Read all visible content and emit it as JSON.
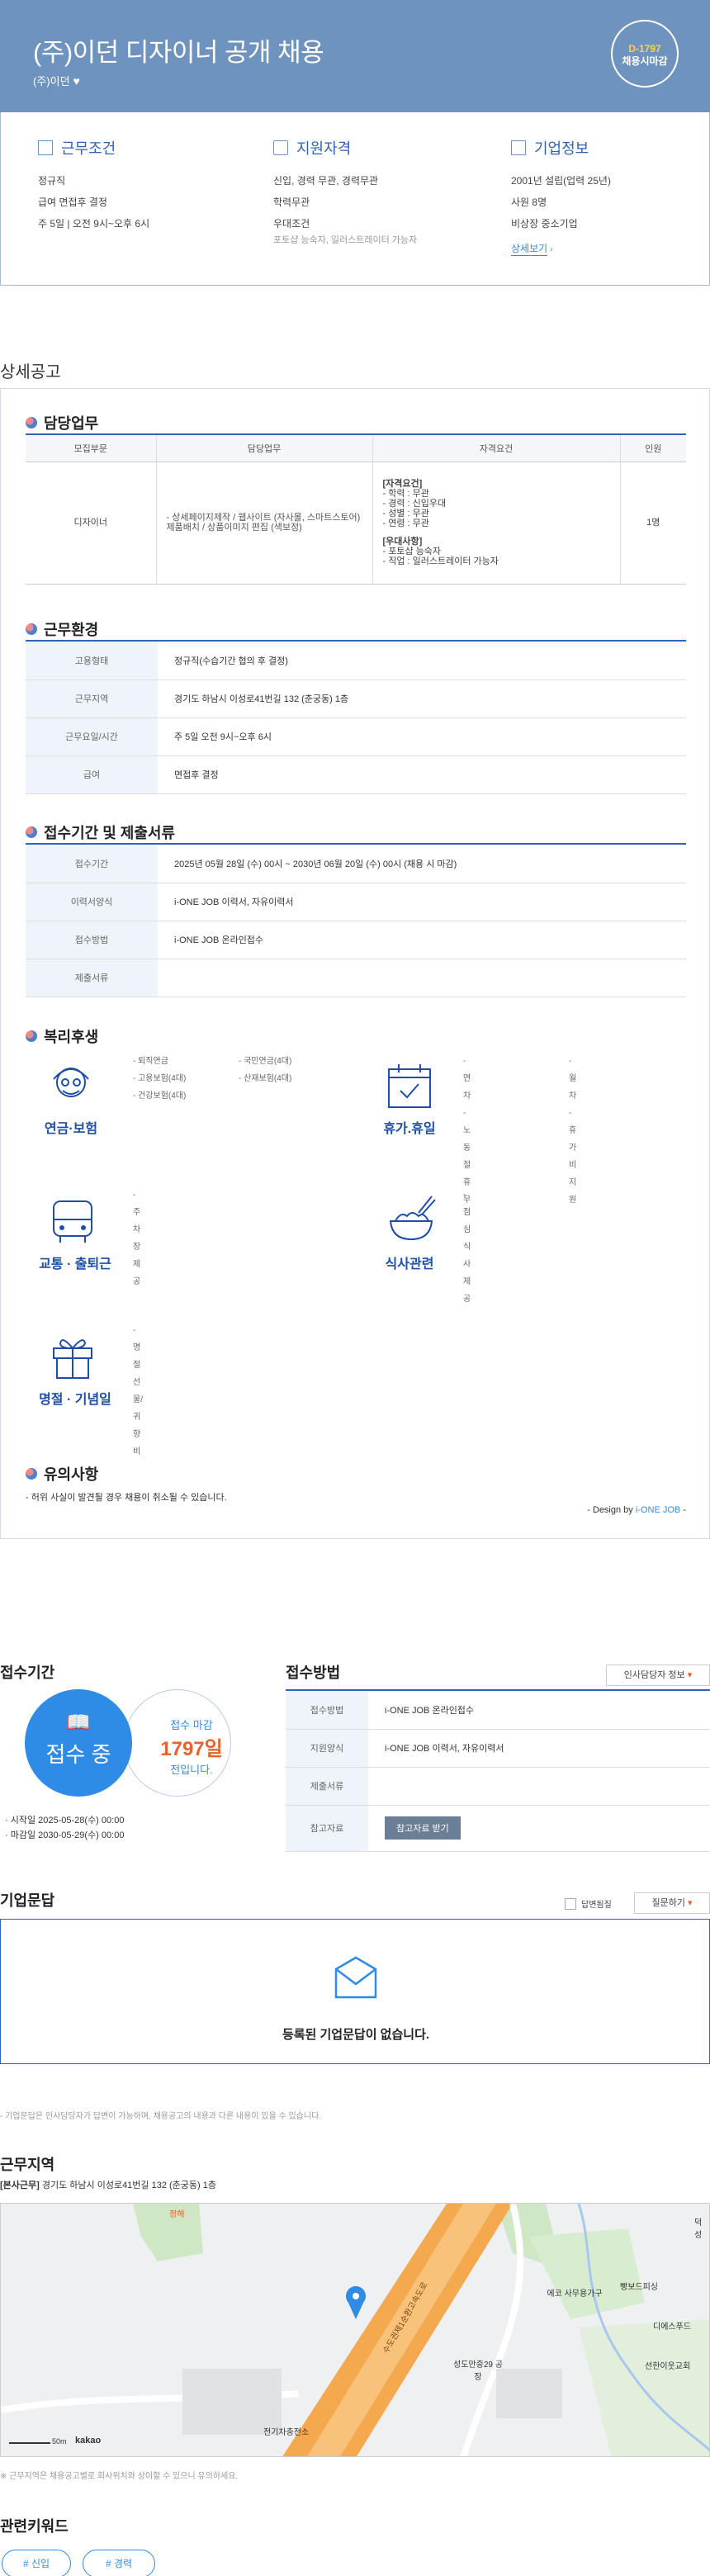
{
  "header": {
    "title": "(주)이던 디자이너 공개 채용",
    "company": "(주)이던",
    "dday": "D-1797",
    "dday_status": "채용시마감"
  },
  "summary": {
    "work": {
      "title": "근무조건",
      "lines": [
        "정규직",
        "급여 면접후 결정",
        "주 5일 | 오전 9시~오후 6시"
      ]
    },
    "qual": {
      "title": "지원자격",
      "lines": [
        "신입, 경력 무관, 경력무관",
        "학력무관",
        "우대조건"
      ],
      "sub": "포토샵 능숙자, 일러스트레이터 가능자"
    },
    "company": {
      "title": "기업정보",
      "lines": [
        "2001년 설립(업력 25년)",
        "사원 8명",
        "비상장 중소기업"
      ],
      "more": "상세보기"
    }
  },
  "detail_title": "상세공고",
  "duty": {
    "title": "담당업무",
    "headers": [
      "모집부문",
      "담당업무",
      "자격요건",
      "인원"
    ],
    "row": {
      "part": "디자이너",
      "task": "- 상세페이지제작 / 웹사이트 (자사몰, 스마트스토어)제품배치 / 상품이미지 편집 (색보정)",
      "req_title": "[자격요건]",
      "req": [
        "- 학력 : 무관",
        "- 경력 : 신입우대",
        "- 성별 : 무관",
        "- 연령 : 무관"
      ],
      "pref_title": "[우대사항]",
      "pref": [
        "- 포토샵 능숙자",
        "- 직업 : 일러스트레이터 가능자"
      ],
      "count": "1명"
    }
  },
  "env": {
    "title": "근무환경",
    "rows": [
      {
        "k": "고용형태",
        "v": "정규직(수습기간 협의 후 결정)"
      },
      {
        "k": "근무지역",
        "v": "경기도 하남시 이성로41번길 132 (춘궁동) 1층"
      },
      {
        "k": "근무요일/시간",
        "v": "주 5일 오전 9시~오후 6시"
      },
      {
        "k": "급여",
        "v": "면접후 결정"
      }
    ]
  },
  "apply": {
    "title": "접수기간 및 제출서류",
    "rows": [
      {
        "k": "접수기간",
        "v": "2025년 05월 28일 (수) 00시 ~ 2030년 06월 20일 (수) 00시 (채용 시 마감)"
      },
      {
        "k": "이력서양식",
        "v": "i-ONE JOB 이력서, 자유이력서"
      },
      {
        "k": "접수방법",
        "v": "i-ONE JOB 온라인접수"
      },
      {
        "k": "제출서류",
        "v": ""
      }
    ]
  },
  "welfare": {
    "title": "복리후생",
    "pension": {
      "label": "연금·보험",
      "a": [
        "- 퇴직연금",
        "- 고용보험(4대)",
        "- 건강보험(4대)"
      ],
      "b": [
        "- 국민연금(4대)",
        "- 산재보험(4대)"
      ]
    },
    "vacation": {
      "label": "휴가.휴일",
      "a": [
        "- 연차",
        "- 노동절휴무"
      ],
      "b": [
        "- 월차",
        "- 휴가비지원"
      ]
    },
    "transport": {
      "label": "교통 · 출퇴근",
      "a": [
        "- 주차장제공"
      ]
    },
    "meal": {
      "label": "식사관련",
      "a": [
        "- 점심식사제공"
      ]
    },
    "holiday": {
      "label": "명절 · 기념일",
      "a": [
        "- 명절선물/귀향비"
      ]
    }
  },
  "notice": {
    "title": "유의사항",
    "text": "- 허위 사실이 발견될 경우 채용이 취소될 수 있습니다.",
    "design": "- Design by ",
    "design_brand": "i-ONE JOB",
    "design_end": " -"
  },
  "period": {
    "title": "접수기간",
    "status": "접수 중",
    "deadline_label": "접수 마감",
    "days": "1797일",
    "days_suffix": "전입니다.",
    "start": "· 시작일 2025-05-28(수) 00:00",
    "end": "· 마감일 2030-05-29(수) 00:00"
  },
  "method": {
    "title": "접수방법",
    "contact_btn": "인사담당자 정보",
    "rows": [
      {
        "k": "접수방법",
        "v": "i-ONE JOB 온라인접수"
      },
      {
        "k": "지원양식",
        "v": "i-ONE JOB 이력서, 자유이력서"
      },
      {
        "k": "제출서류",
        "v": ""
      },
      {
        "k": "참고자료",
        "v": ""
      }
    ],
    "ref_btn": "참고자료 받기"
  },
  "qa": {
    "title": "기업문답",
    "check": "답변됨질",
    "ask": "질문하기",
    "empty": "등록된 기업문답이 없습니다.",
    "note": "- 기업문답은 인사담당자가 답변이 가능하며, 채용공고의 내용과 다른 내용이 있을 수 있습니다."
  },
  "location": {
    "title": "근무지역",
    "tag": "[본사근무]",
    "address": "경기도 하남시 이성로41번길 132 (춘궁동) 1층",
    "note": "※ 근무지역은 채용공고별로 회사위치와 상이할 수 있으니 유의하세요.",
    "map_labels": {
      "road": "수도권제1순환고속도로",
      "pin_place": "",
      "l1": "빵보드피싱",
      "l2": "에코 사무용가구",
      "l3": "디에스푸드",
      "l4": "선한이웃교회",
      "l5": "성도만중29 공장",
      "l6": "전기차충전소",
      "l7": "정해",
      "l8": "덕성",
      "scale": "50m",
      "brand": "kakao"
    }
  },
  "keywords": {
    "title": "관련키워드",
    "items": [
      "# 신입",
      "# 경력"
    ]
  }
}
